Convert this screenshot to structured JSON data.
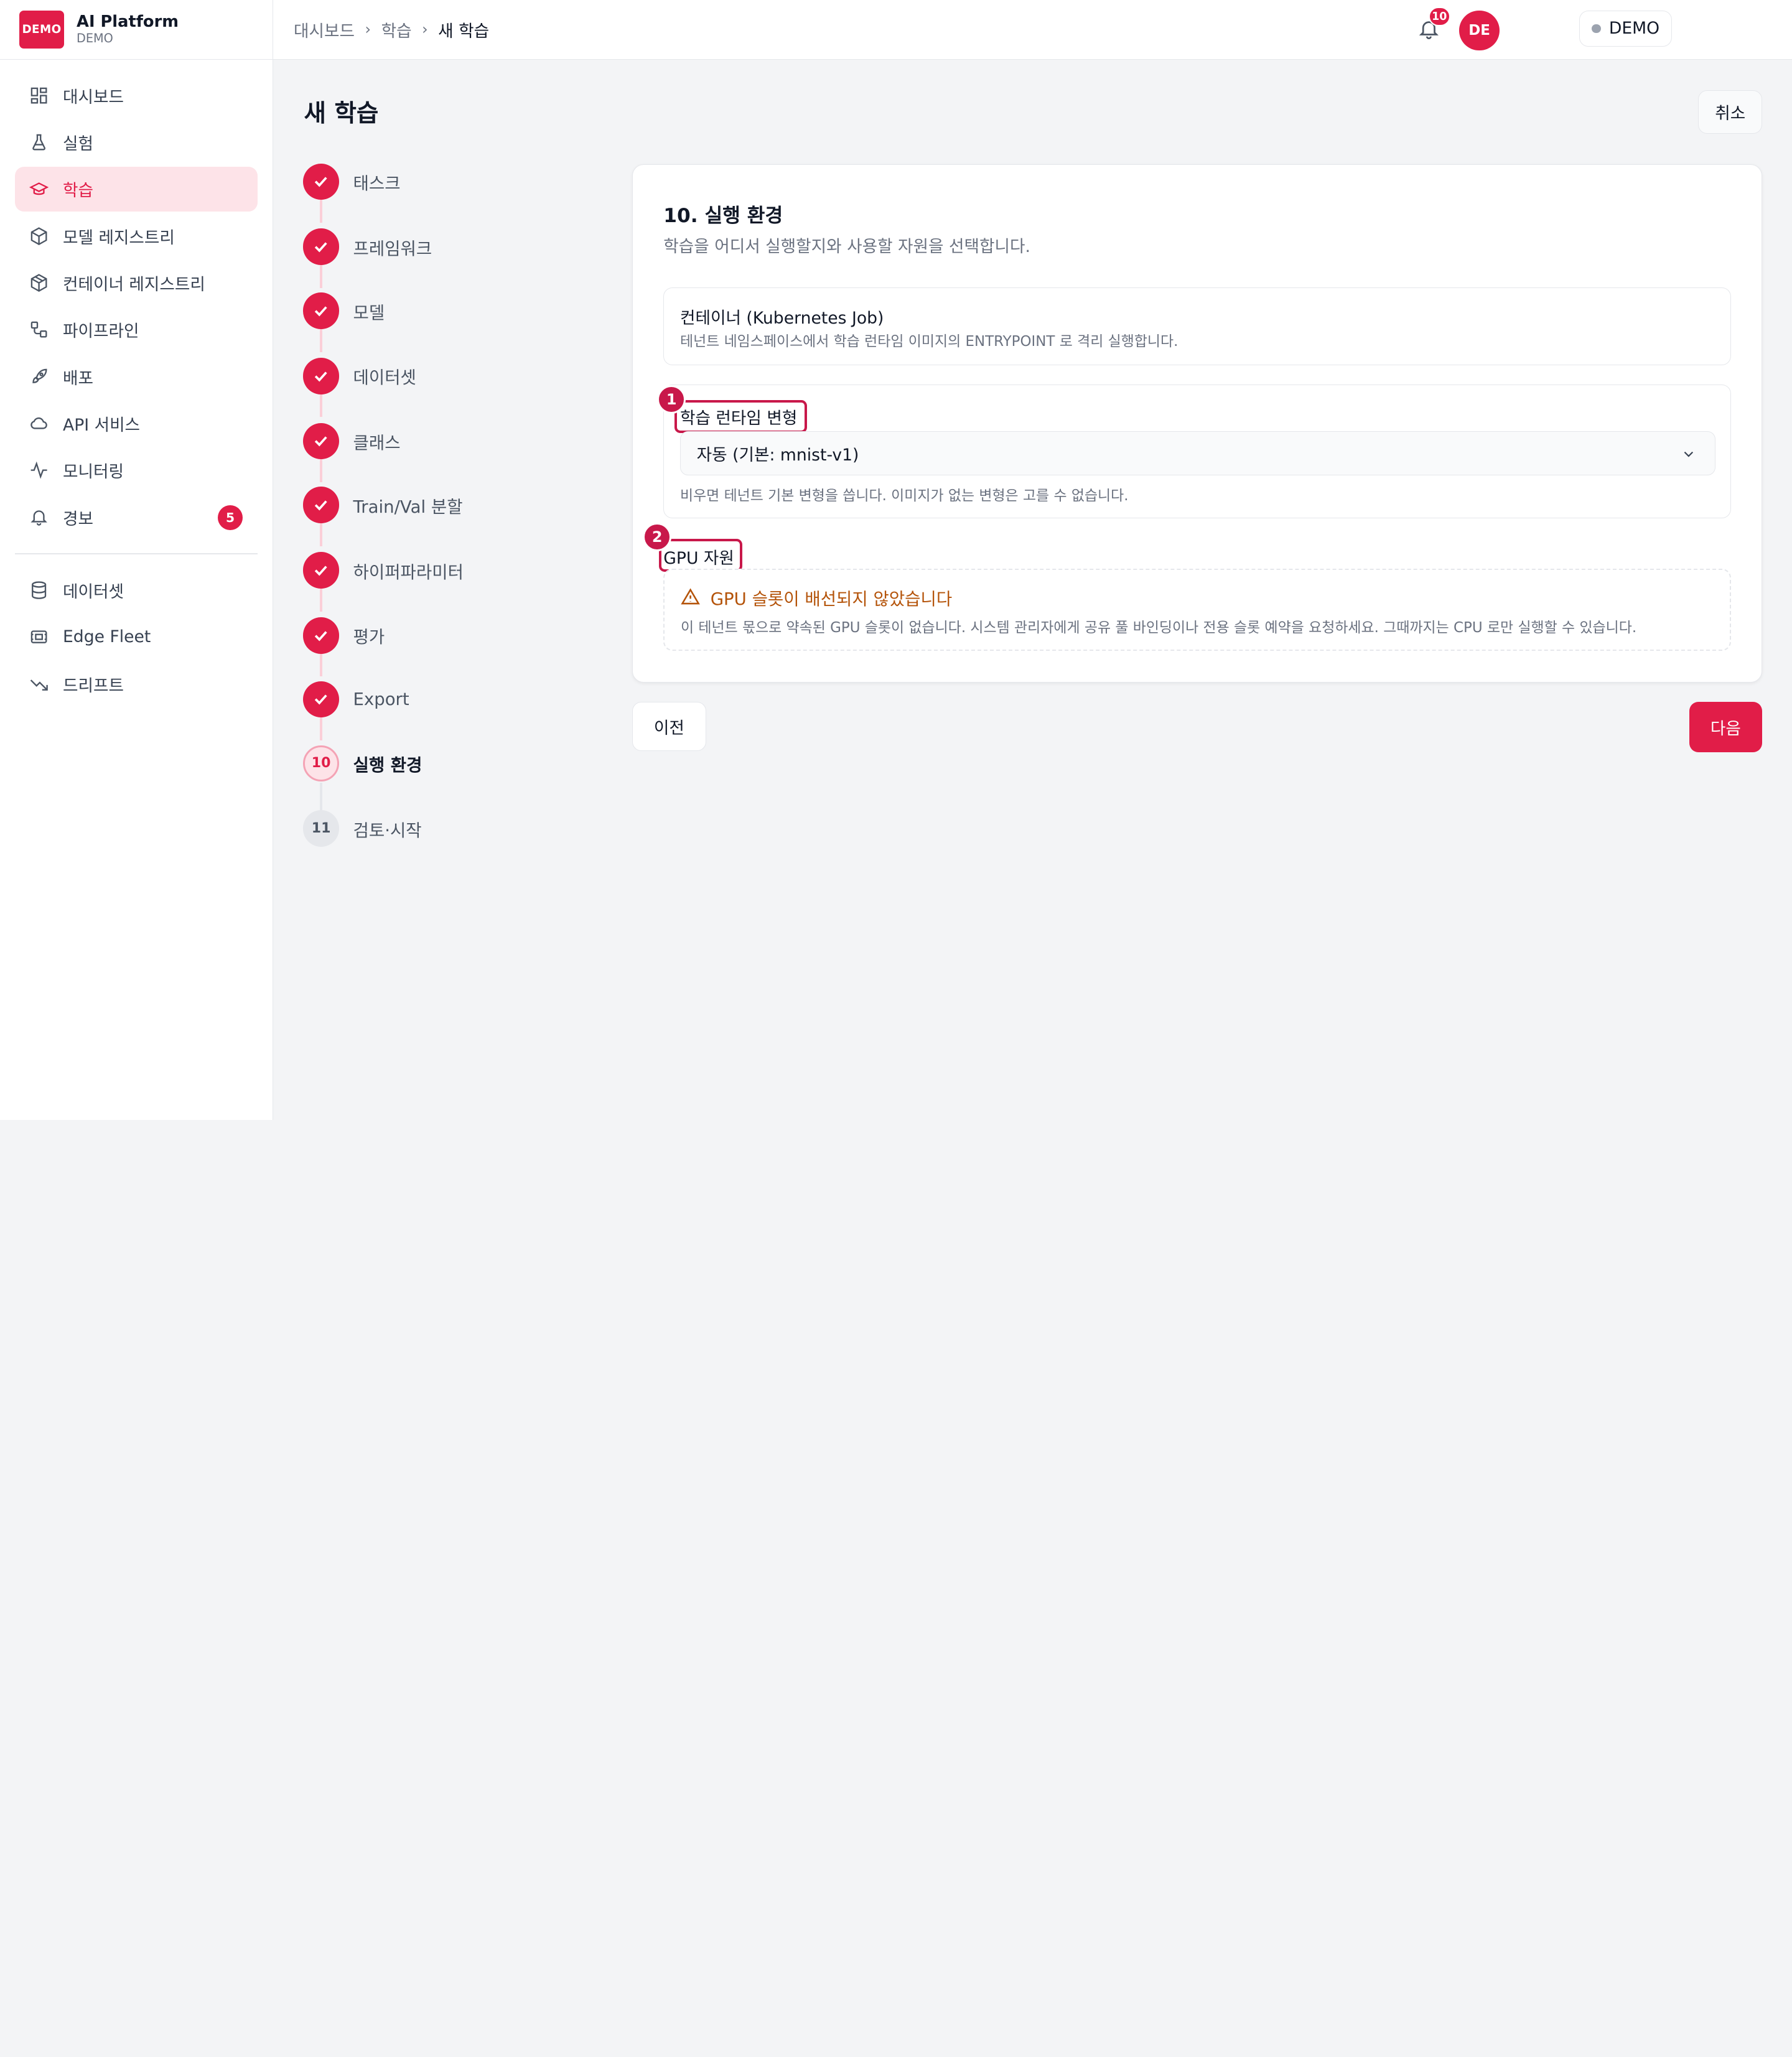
{
  "brand": {
    "logo_text": "DEMO",
    "name": "AI Platform",
    "subtitle": "DEMO"
  },
  "sidebar": {
    "items": [
      {
        "label": "대시보드",
        "icon": "dashboard-icon"
      },
      {
        "label": "실험",
        "icon": "flask-icon"
      },
      {
        "label": "학습",
        "icon": "graduation-cap-icon",
        "active": true
      },
      {
        "label": "모델 레지스트리",
        "icon": "cube-icon"
      },
      {
        "label": "컨테이너 레지스트리",
        "icon": "container-icon"
      },
      {
        "label": "파이프라인",
        "icon": "pipeline-icon"
      },
      {
        "label": "배포",
        "icon": "rocket-icon"
      },
      {
        "label": "API 서비스",
        "icon": "cloud-icon"
      },
      {
        "label": "모니터링",
        "icon": "activity-icon"
      },
      {
        "label": "경보",
        "icon": "bell-icon",
        "badge": "5"
      }
    ],
    "secondary_items": [
      {
        "label": "데이터셋",
        "icon": "database-icon"
      },
      {
        "label": "Edge Fleet",
        "icon": "cpu-icon"
      },
      {
        "label": "드리프트",
        "icon": "trending-down-icon"
      }
    ]
  },
  "header": {
    "breadcrumb": [
      "대시보드",
      "학습",
      "새 학습"
    ],
    "env_chip": "DEMO",
    "notification_count": "10",
    "avatar_initials": "DE"
  },
  "page": {
    "title": "새 학습",
    "cancel_label": "취소"
  },
  "steps": [
    {
      "label": "태스크",
      "status": "done"
    },
    {
      "label": "프레임워크",
      "status": "done"
    },
    {
      "label": "모델",
      "status": "done"
    },
    {
      "label": "데이터셋",
      "status": "done"
    },
    {
      "label": "클래스",
      "status": "done"
    },
    {
      "label": "Train/Val 분할",
      "status": "done"
    },
    {
      "label": "하이퍼파라미터",
      "status": "done"
    },
    {
      "label": "평가",
      "status": "done"
    },
    {
      "label": "Export",
      "status": "done"
    },
    {
      "label": "실행 환경",
      "status": "current",
      "number": "10"
    },
    {
      "label": "검토·시작",
      "status": "upcoming",
      "number": "11"
    }
  ],
  "card": {
    "title": "10. 실행 환경",
    "description": "학습을 어디서 실행할지와 사용할 자원을 선택합니다.",
    "container_option": {
      "title": "컨테이너 (Kubernetes Job)",
      "description": "테넌트 네임스페이스에서 학습 런타임 이미지의 ENTRYPOINT 로 격리 실행합니다."
    },
    "runtime_variant": {
      "label": "학습 런타임 변형",
      "selected": "자동 (기본: mnist-v1)",
      "help": "비우면 테넌트 기본 변형을 씁니다. 이미지가 없는 변형은 고를 수 없습니다."
    },
    "gpu": {
      "label": "GPU 자원",
      "warning_title": "GPU 슬롯이 배선되지 않았습니다",
      "warning_desc": "이 테넌트 몫으로 약속된 GPU 슬롯이 없습니다. 시스템 관리자에게 공유 풀 바인딩이나 전용 슬롯 예약을 요청하세요. 그때까지는 CPU 로만 실행할 수 있습니다."
    }
  },
  "annotations": {
    "one": "1",
    "two": "2"
  },
  "footer": {
    "prev_label": "이전",
    "next_label": "다음"
  },
  "colors": {
    "accent": "#e11d48",
    "accent_soft": "#fde3e8",
    "warning": "#b45309",
    "annotation": "#c8184a"
  }
}
